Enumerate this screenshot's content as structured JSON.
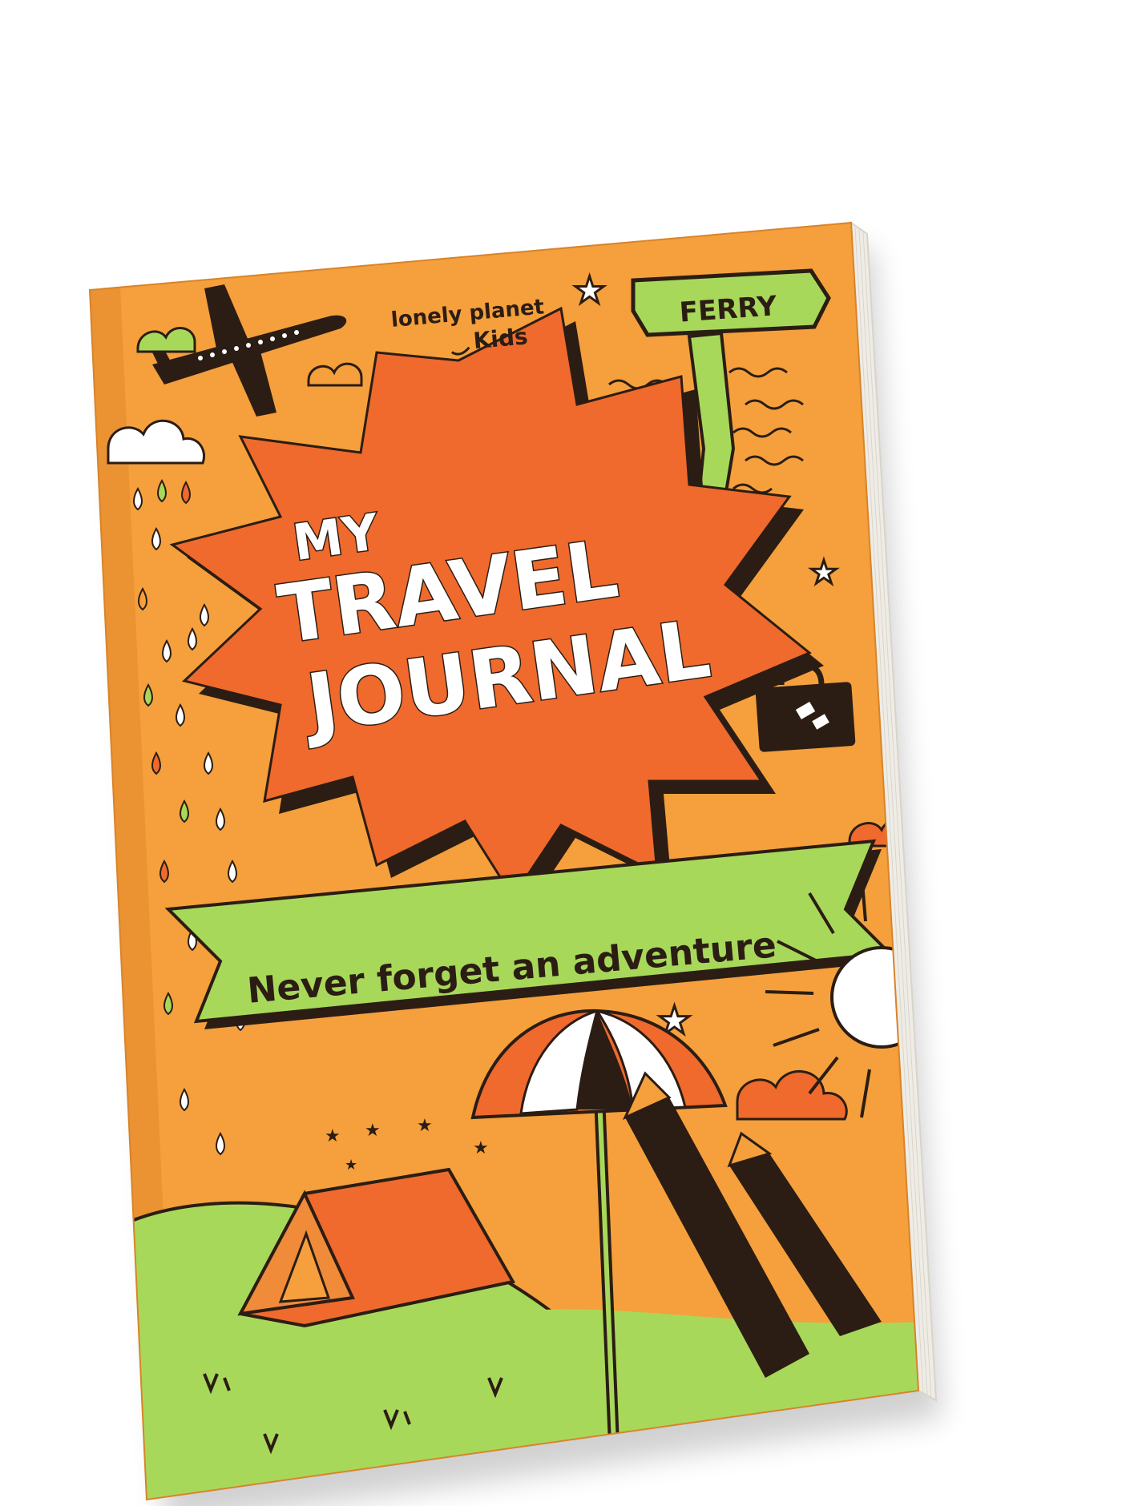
{
  "brand": {
    "line1": "lonely planet",
    "line2": "Kids"
  },
  "sign": {
    "label": "FERRY"
  },
  "title": {
    "line1": "MY",
    "line2": "TRAVEL",
    "line3": "JOURNAL"
  },
  "tagline": "Never forget an adventure",
  "colors": {
    "cover_orange": "#f5a03c",
    "burst_orange": "#ef6a2c",
    "green": "#a8d85a",
    "dark": "#2b1d14",
    "white": "#ffffff"
  },
  "icons": [
    "airplane-icon",
    "cloud-icon",
    "star-icon",
    "suitcase-icon",
    "tent-icon",
    "umbrella-icon",
    "sun-icon",
    "pencil-icon",
    "raindrop-icon",
    "wave-icon"
  ]
}
